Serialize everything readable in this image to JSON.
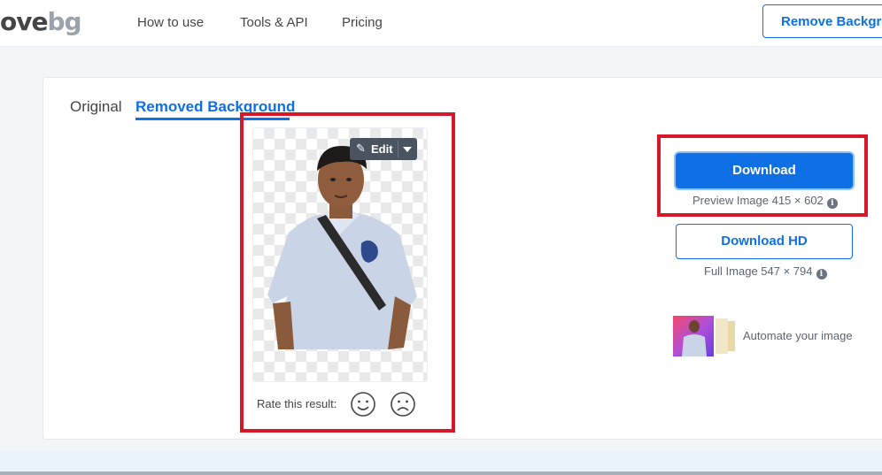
{
  "header": {
    "logo_part1": "ove",
    "logo_part2": "bg",
    "nav": [
      "How to use",
      "Tools & API",
      "Pricing"
    ],
    "cta_label": "Remove Background"
  },
  "tabs": {
    "original": "Original",
    "removed": "Removed Background"
  },
  "preview": {
    "edit_label": "Edit",
    "rate_label": "Rate this result:"
  },
  "downloads": {
    "download_label": "Download",
    "preview_info": "Preview Image 415 × 602",
    "download_hd_label": "Download HD",
    "full_info": "Full Image 547 × 794"
  },
  "automate": {
    "label": "Automate your image"
  },
  "colors": {
    "accent": "#0f70e6",
    "highlight": "#d6182a"
  }
}
